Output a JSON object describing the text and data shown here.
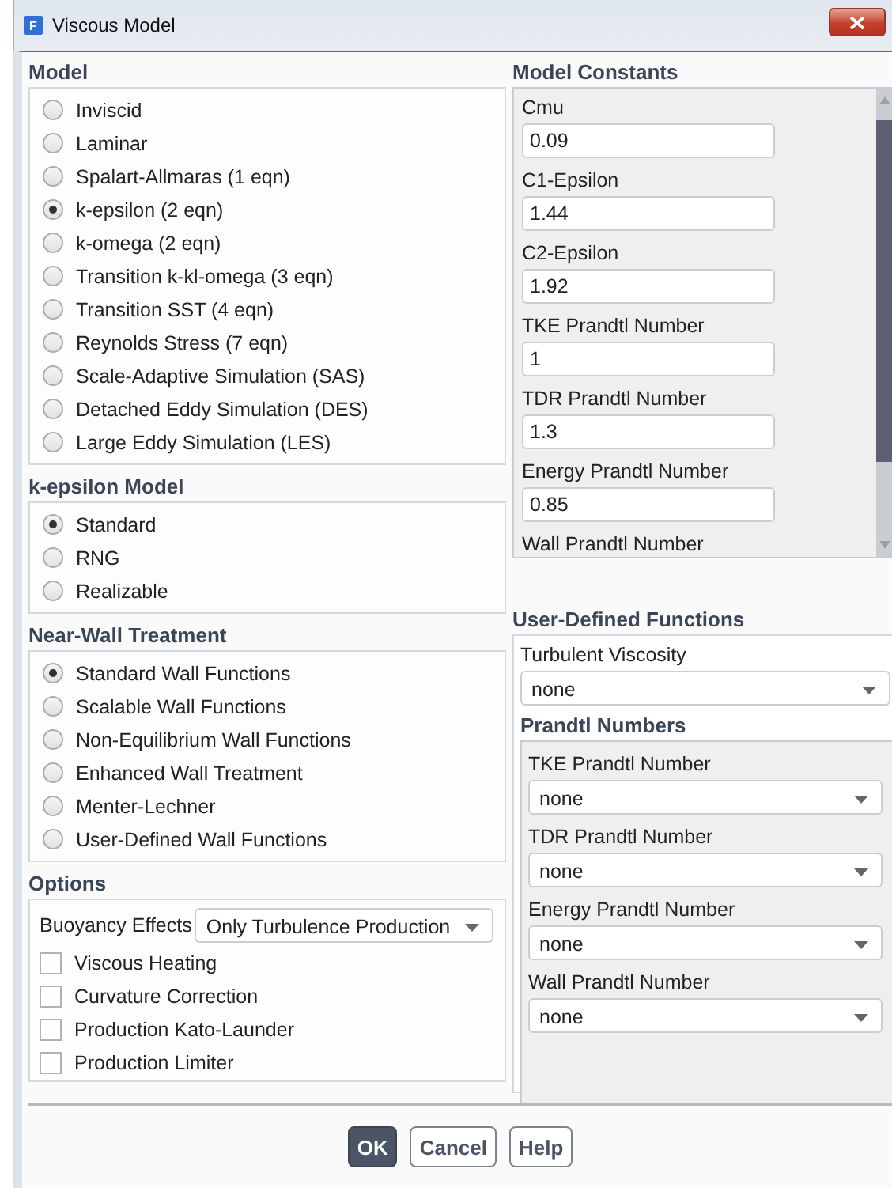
{
  "window": {
    "icon_letter": "F",
    "title": "Viscous Model"
  },
  "model": {
    "heading": "Model",
    "options": [
      {
        "label": "Inviscid",
        "selected": false
      },
      {
        "label": "Laminar",
        "selected": false
      },
      {
        "label": "Spalart-Allmaras (1 eqn)",
        "selected": false
      },
      {
        "label": "k-epsilon (2 eqn)",
        "selected": true
      },
      {
        "label": "k-omega (2 eqn)",
        "selected": false
      },
      {
        "label": "Transition k-kl-omega (3 eqn)",
        "selected": false
      },
      {
        "label": "Transition SST (4 eqn)",
        "selected": false
      },
      {
        "label": "Reynolds Stress (7 eqn)",
        "selected": false
      },
      {
        "label": "Scale-Adaptive Simulation (SAS)",
        "selected": false
      },
      {
        "label": "Detached Eddy Simulation (DES)",
        "selected": false
      },
      {
        "label": "Large Eddy Simulation (LES)",
        "selected": false
      }
    ]
  },
  "k_epsilon_model": {
    "heading": "k-epsilon Model",
    "options": [
      {
        "label": "Standard",
        "selected": true
      },
      {
        "label": "RNG",
        "selected": false
      },
      {
        "label": "Realizable",
        "selected": false
      }
    ]
  },
  "near_wall_treatment": {
    "heading": "Near-Wall Treatment",
    "options": [
      {
        "label": "Standard Wall Functions",
        "selected": true
      },
      {
        "label": "Scalable Wall Functions",
        "selected": false
      },
      {
        "label": "Non-Equilibrium Wall Functions",
        "selected": false
      },
      {
        "label": "Enhanced Wall Treatment",
        "selected": false
      },
      {
        "label": "Menter-Lechner",
        "selected": false
      },
      {
        "label": "User-Defined Wall Functions",
        "selected": false
      }
    ]
  },
  "options": {
    "heading": "Options",
    "buoyancy": {
      "label": "Buoyancy Effects",
      "value": "Only Turbulence Production"
    },
    "checkboxes": [
      {
        "label": "Viscous Heating",
        "checked": false
      },
      {
        "label": "Curvature Correction",
        "checked": false
      },
      {
        "label": "Production Kato-Launder",
        "checked": false
      },
      {
        "label": "Production Limiter",
        "checked": false
      }
    ]
  },
  "model_constants": {
    "heading": "Model Constants",
    "items": [
      {
        "kind": "field",
        "label": "Cmu",
        "value": "0.09"
      },
      {
        "kind": "field",
        "label": "C1-Epsilon",
        "value": "1.44"
      },
      {
        "kind": "field",
        "label": "C2-Epsilon",
        "value": "1.92"
      },
      {
        "kind": "field",
        "label": "TKE Prandtl Number",
        "value": "1"
      },
      {
        "kind": "field",
        "label": "TDR Prandtl Number",
        "value": "1.3"
      },
      {
        "kind": "field",
        "label": "Energy Prandtl Number",
        "value": "0.85"
      },
      {
        "kind": "label",
        "label": "Wall Prandtl Number"
      }
    ]
  },
  "user_defined_functions": {
    "heading": "User-Defined Functions",
    "turbulent_viscosity": {
      "label": "Turbulent Viscosity",
      "value": "none"
    },
    "prandtl_numbers": {
      "heading": "Prandtl Numbers",
      "fields": [
        {
          "label": "TKE Prandtl Number",
          "value": "none"
        },
        {
          "label": "TDR Prandtl Number",
          "value": "none"
        },
        {
          "label": "Energy Prandtl Number",
          "value": "none"
        },
        {
          "label": "Wall Prandtl Number",
          "value": "none"
        }
      ]
    }
  },
  "buttons": [
    {
      "label": "OK",
      "primary": true
    },
    {
      "label": "Cancel",
      "primary": false
    },
    {
      "label": "Help",
      "primary": false
    }
  ]
}
